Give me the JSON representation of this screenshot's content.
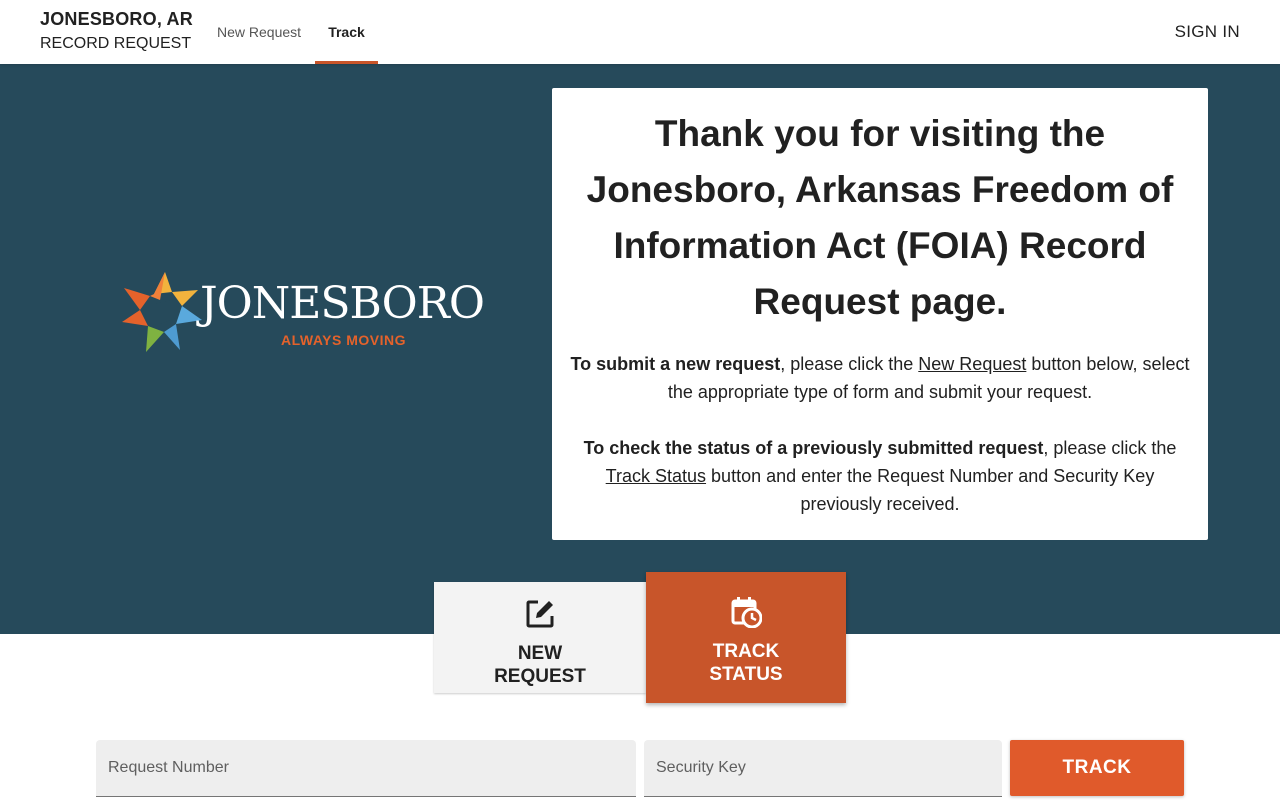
{
  "header": {
    "city": "JONESBORO, AR",
    "subtitle": "RECORD REQUEST",
    "nav": [
      {
        "label": "New Request"
      },
      {
        "label": "Track"
      }
    ],
    "sign_in": "SIGN IN"
  },
  "logo": {
    "wordmark": "JONESBORO",
    "tagline": "ALWAYS MOVING"
  },
  "welcome": {
    "heading": "Thank you for visiting the Jonesboro, Arkansas Freedom of Information Act (FOIA) Record Request page.",
    "p1_bold": "To submit a new request",
    "p1_a": ", please click the ",
    "p1_link": "New Request",
    "p1_b": " button below, select the appropriate type of form and submit your request.",
    "p2_bold": "To check the status of a previously submitted request",
    "p2_a": ", please click the ",
    "p2_link": "Track Status",
    "p2_b": " button and enter the Request Number and Security Key previously received."
  },
  "actions": {
    "new_line1": "NEW",
    "new_line2": "REQUEST",
    "track_line1": "TRACK",
    "track_line2": "STATUS"
  },
  "form": {
    "request_number_placeholder": "Request Number",
    "security_key_placeholder": "Security Key",
    "track_label": "TRACK"
  },
  "colors": {
    "accent": "#c8552a",
    "button": "#e05a2b",
    "hero": "#264a5b"
  }
}
